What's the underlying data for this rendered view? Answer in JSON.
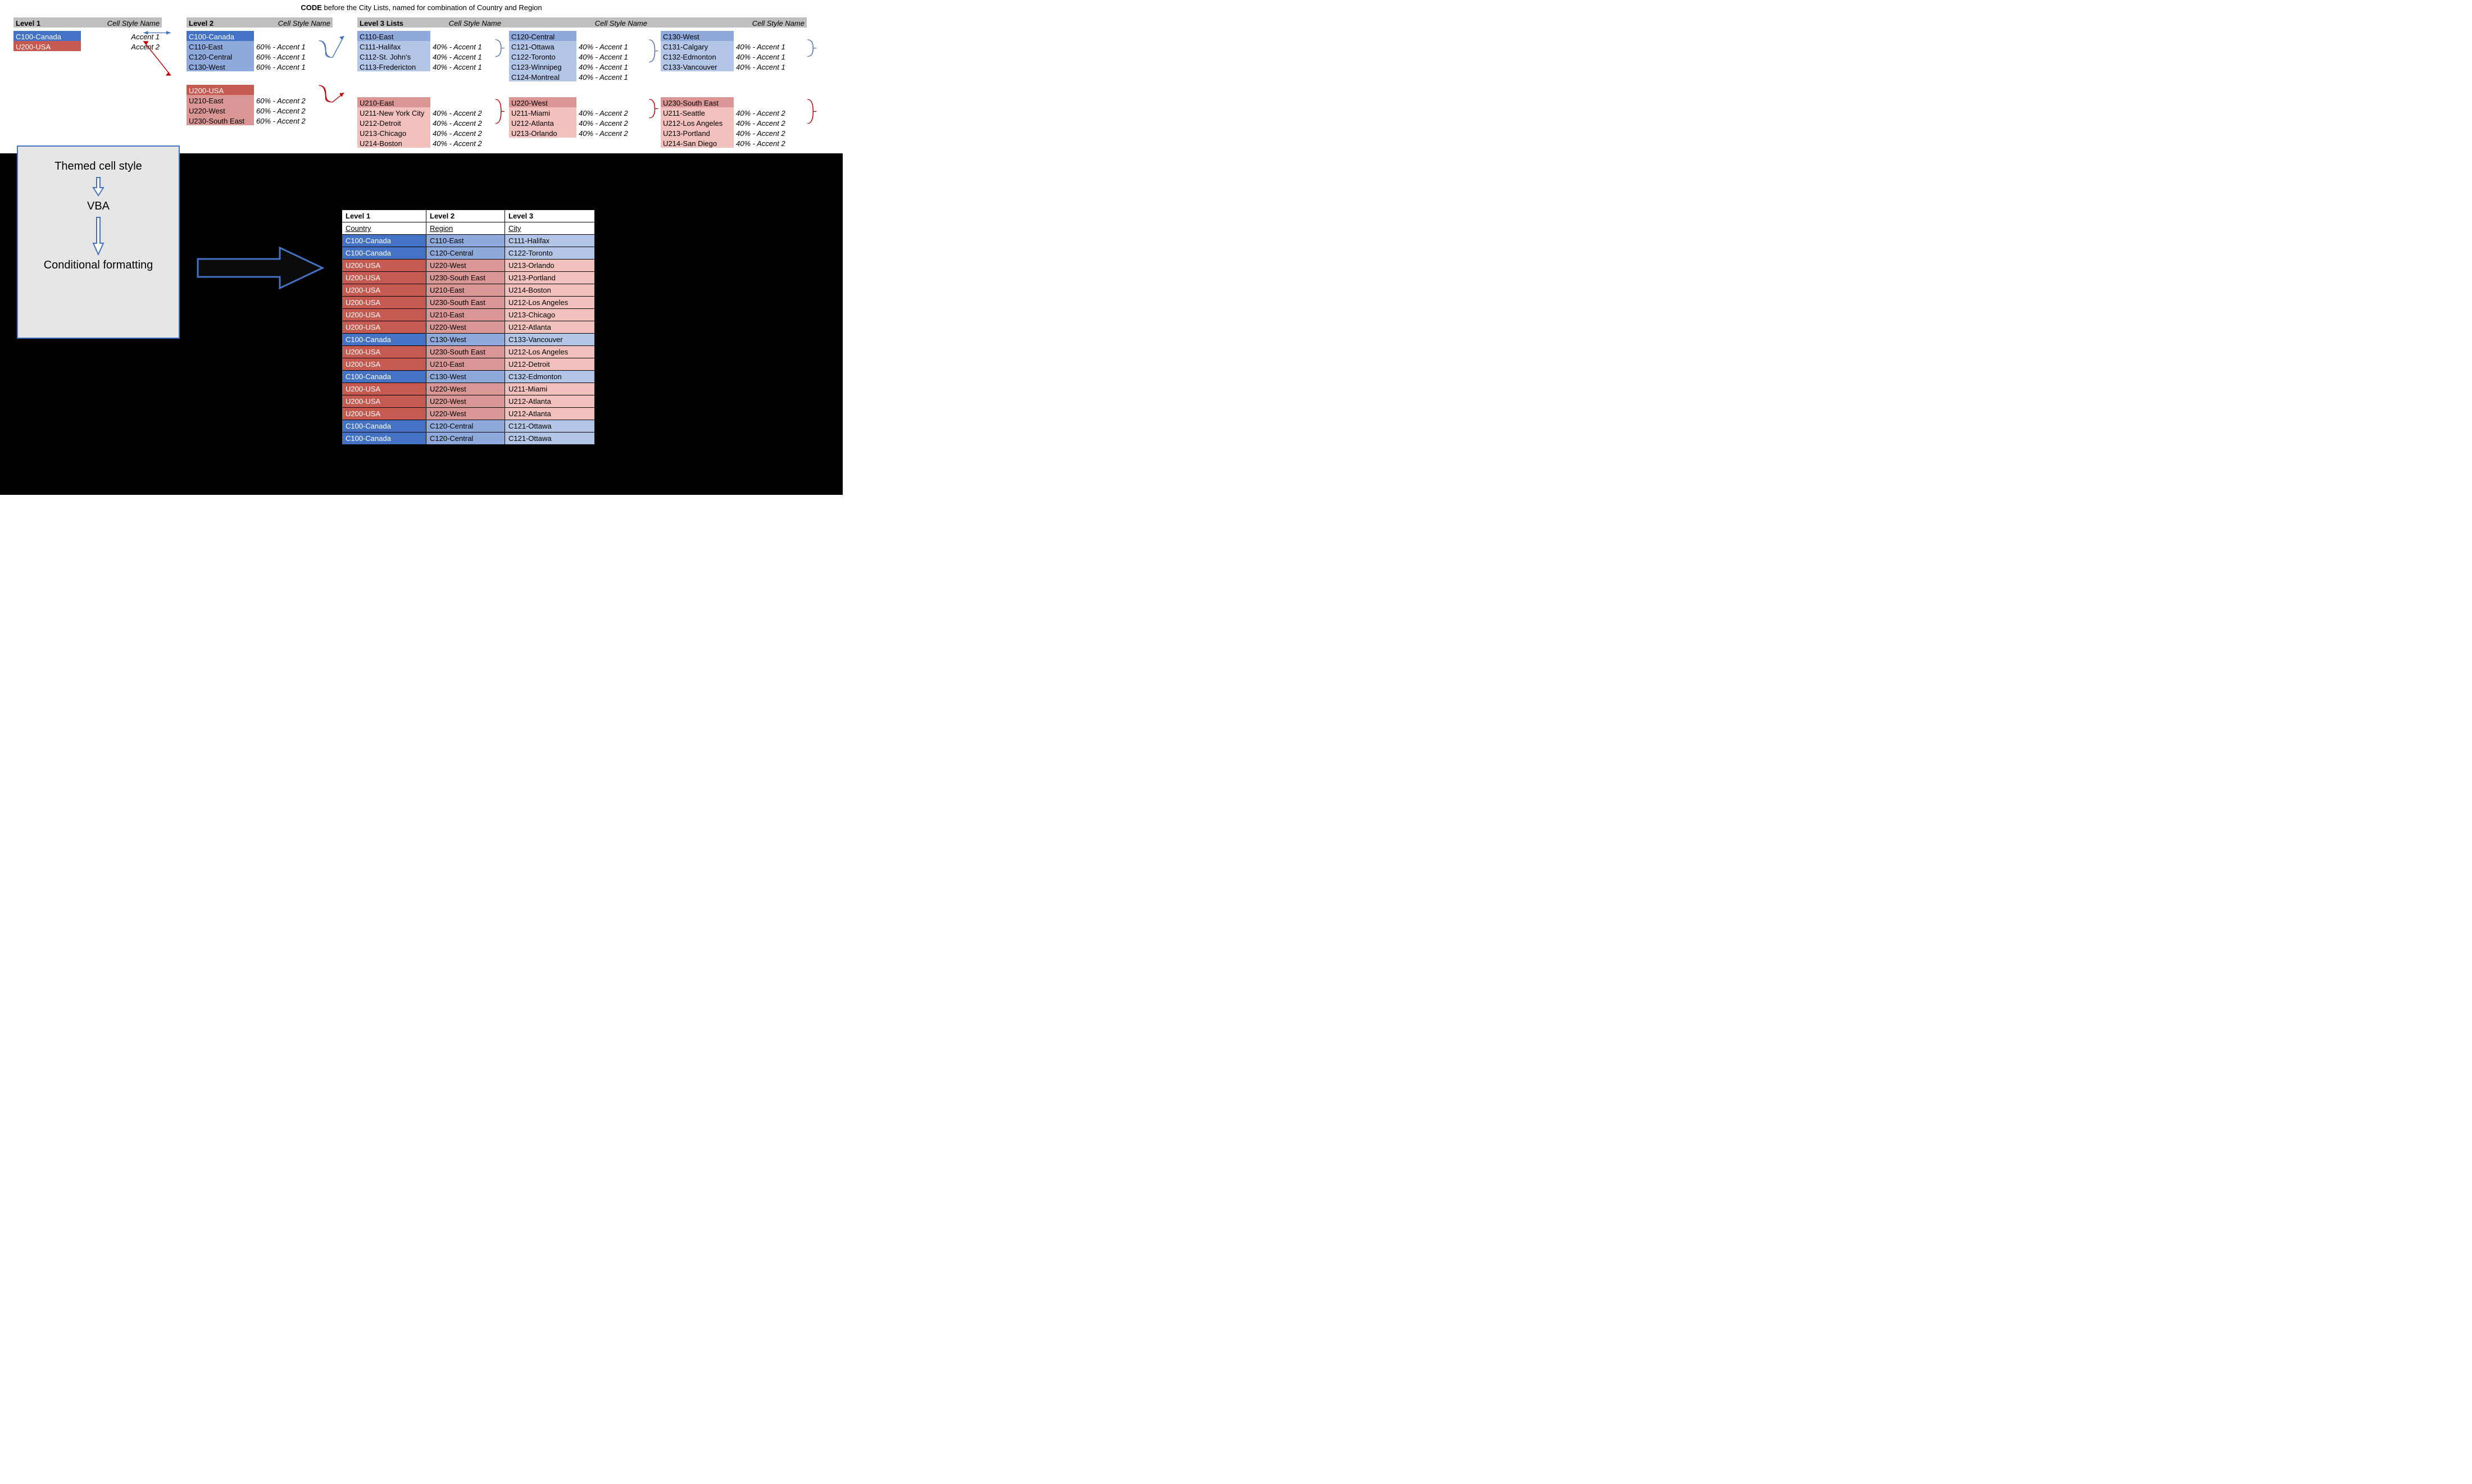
{
  "title": {
    "bold": "CODE",
    "rest": " before the City Lists, named for combination of Country and Region"
  },
  "headers": {
    "level1": "Level 1",
    "level2": "Level 2",
    "level3": "Level 3 Lists",
    "styleName": "Cell Style Name"
  },
  "level1": {
    "items": [
      {
        "label": "C100-Canada",
        "cls": "accent1-dark",
        "style": "Accent 1"
      },
      {
        "label": "U200-USA",
        "cls": "accent2-dark",
        "style": "Accent 2"
      }
    ]
  },
  "level2": {
    "canada": [
      {
        "label": "C100-Canada",
        "cls": "accent1-dark",
        "style": ""
      },
      {
        "label": "C110-East",
        "cls": "accent1-60",
        "style": "60% - Accent 1"
      },
      {
        "label": "C120-Central",
        "cls": "accent1-60",
        "style": "60% - Accent 1"
      },
      {
        "label": "C130-West",
        "cls": "accent1-60",
        "style": "60% - Accent 1"
      }
    ],
    "usa": [
      {
        "label": "U200-USA",
        "cls": "accent2-dark",
        "style": ""
      },
      {
        "label": "U210-East",
        "cls": "accent2-60",
        "style": "60% - Accent 2"
      },
      {
        "label": "U220-West",
        "cls": "accent2-60",
        "style": "60% - Accent 2"
      },
      {
        "label": "U230-South East",
        "cls": "accent2-60",
        "style": "60% - Accent 2"
      }
    ]
  },
  "level3": {
    "c110": {
      "head": "C110-East",
      "items": [
        "C111-Halifax",
        "C112-St. John's",
        "C113-Fredericton"
      ],
      "style": "40% - Accent 1",
      "cls": "accent1-40",
      "hcls": "accent1-60"
    },
    "c120": {
      "head": "C120-Central",
      "items": [
        "C121-Ottawa",
        "C122-Toronto",
        "C123-Winnipeg",
        "C124-Montreal"
      ],
      "style": "40% - Accent 1",
      "cls": "accent1-40",
      "hcls": "accent1-60"
    },
    "c130": {
      "head": "C130-West",
      "items": [
        "C131-Calgary",
        "C132-Edmonton",
        "C133-Vancouver"
      ],
      "style": "40% - Accent 1",
      "cls": "accent1-40",
      "hcls": "accent1-60"
    },
    "u210": {
      "head": "U210-East",
      "items": [
        "U211-New York City",
        "U212-Detroit",
        "U213-Chicago",
        "U214-Boston"
      ],
      "style": "40% - Accent 2",
      "cls": "accent2-40",
      "hcls": "accent2-60"
    },
    "u220": {
      "head": "U220-West",
      "items": [
        "U211-Miami",
        "U212-Atlanta",
        "U213-Orlando"
      ],
      "style": "40% - Accent 2",
      "cls": "accent2-40",
      "hcls": "accent2-60"
    },
    "u230": {
      "head": "U230-South East",
      "items": [
        "U211-Seattle",
        "U212-Los Angeles",
        "U213-Portland",
        "U214-San Diego"
      ],
      "style": "40% - Accent 2",
      "cls": "accent2-40",
      "hcls": "accent2-60"
    }
  },
  "flow": {
    "step1": "Themed cell style",
    "step2": "VBA",
    "step3": "Conditional formatting"
  },
  "resultHeaders": {
    "l1": "Level 1",
    "l2": "Level 2",
    "l3": "Level 3",
    "country": "Country",
    "region": "Region",
    "city": "City"
  },
  "resultRows": [
    {
      "c": "C100-Canada",
      "cc": "accent1-dark",
      "r": "C110-East",
      "rc": "accent1-60",
      "ci": "C111-Halifax",
      "cic": "accent1-40"
    },
    {
      "c": "C100-Canada",
      "cc": "accent1-dark",
      "r": "C120-Central",
      "rc": "accent1-60",
      "ci": "C122-Toronto",
      "cic": "accent1-40"
    },
    {
      "c": "U200-USA",
      "cc": "accent2-dark",
      "r": "U220-West",
      "rc": "accent2-60",
      "ci": "U213-Orlando",
      "cic": "accent2-40"
    },
    {
      "c": "U200-USA",
      "cc": "accent2-dark",
      "r": "U230-South East",
      "rc": "accent2-60",
      "ci": "U213-Portland",
      "cic": "accent2-40"
    },
    {
      "c": "U200-USA",
      "cc": "accent2-dark",
      "r": "U210-East",
      "rc": "accent2-60",
      "ci": "U214-Boston",
      "cic": "accent2-40"
    },
    {
      "c": "U200-USA",
      "cc": "accent2-dark",
      "r": "U230-South East",
      "rc": "accent2-60",
      "ci": "U212-Los Angeles",
      "cic": "accent2-40"
    },
    {
      "c": "U200-USA",
      "cc": "accent2-dark",
      "r": "U210-East",
      "rc": "accent2-60",
      "ci": "U213-Chicago",
      "cic": "accent2-40"
    },
    {
      "c": "U200-USA",
      "cc": "accent2-dark",
      "r": "U220-West",
      "rc": "accent2-60",
      "ci": "U212-Atlanta",
      "cic": "accent2-40"
    },
    {
      "c": "C100-Canada",
      "cc": "accent1-dark",
      "r": "C130-West",
      "rc": "accent1-60",
      "ci": "C133-Vancouver",
      "cic": "accent1-40"
    },
    {
      "c": "U200-USA",
      "cc": "accent2-dark",
      "r": "U230-South East",
      "rc": "accent2-60",
      "ci": "U212-Los Angeles",
      "cic": "accent2-40"
    },
    {
      "c": "U200-USA",
      "cc": "accent2-dark",
      "r": "U210-East",
      "rc": "accent2-60",
      "ci": "U212-Detroit",
      "cic": "accent2-40"
    },
    {
      "c": "C100-Canada",
      "cc": "accent1-dark",
      "r": "C130-West",
      "rc": "accent1-60",
      "ci": "C132-Edmonton",
      "cic": "accent1-40"
    },
    {
      "c": "U200-USA",
      "cc": "accent2-dark",
      "r": "U220-West",
      "rc": "accent2-60",
      "ci": "U211-Miami",
      "cic": "accent2-40"
    },
    {
      "c": "U200-USA",
      "cc": "accent2-dark",
      "r": "U220-West",
      "rc": "accent2-60",
      "ci": "U212-Atlanta",
      "cic": "accent2-40"
    },
    {
      "c": "U200-USA",
      "cc": "accent2-dark",
      "r": "U220-West",
      "rc": "accent2-60",
      "ci": "U212-Atlanta",
      "cic": "accent2-40"
    },
    {
      "c": "C100-Canada",
      "cc": "accent1-dark",
      "r": "C120-Central",
      "rc": "accent1-60",
      "ci": "C121-Ottawa",
      "cic": "accent1-40"
    },
    {
      "c": "C100-Canada",
      "cc": "accent1-dark",
      "r": "C120-Central",
      "rc": "accent1-60",
      "ci": "C121-Ottawa",
      "cic": "accent1-40"
    }
  ]
}
